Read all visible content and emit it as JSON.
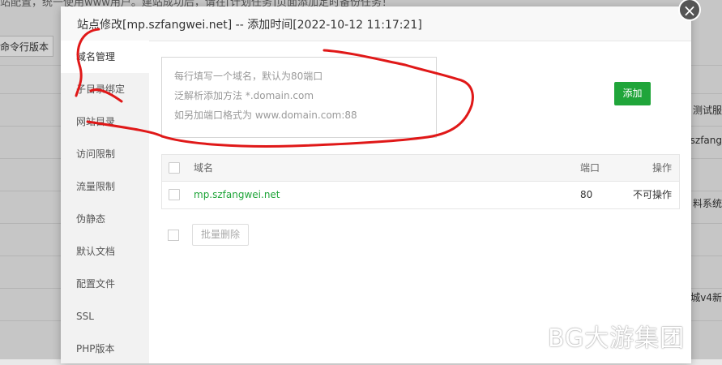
{
  "background": {
    "notice": "站配置，统一使用www用户。建站成功后，请在[计划任务]页面添加定时备份任务！",
    "cmd_button": "命令行版本",
    "right_texts": [
      "测试服",
      "szfang",
      "料系统",
      "城v4新"
    ]
  },
  "modal": {
    "title": "站点修改[mp.szfangwei.net] -- 添加时间[2022-10-12 11:17:21]",
    "close_glyph": "×"
  },
  "menu": {
    "items": [
      {
        "label": "域名管理",
        "active": true
      },
      {
        "label": "子目录绑定",
        "active": false
      },
      {
        "label": "网站目录",
        "active": false
      },
      {
        "label": "访问限制",
        "active": false
      },
      {
        "label": "流量限制",
        "active": false
      },
      {
        "label": "伪静态",
        "active": false
      },
      {
        "label": "默认文档",
        "active": false
      },
      {
        "label": "配置文件",
        "active": false
      },
      {
        "label": "SSL",
        "active": false
      },
      {
        "label": "PHP版本",
        "active": false
      }
    ]
  },
  "domain_input": {
    "hints": [
      "每行填写一个域名，默认为80端口",
      "泛解析添加方法 *.domain.com",
      "如另加端口格式为 www.domain.com:88"
    ]
  },
  "add_button": "添加",
  "table": {
    "headers": {
      "domain": "域名",
      "port": "端口",
      "action": "操作"
    },
    "rows": [
      {
        "domain": "mp.szfangwei.net",
        "port": "80",
        "action": "不可操作"
      }
    ]
  },
  "batch_delete": "批量删除",
  "watermark": "BG大游集团",
  "colors": {
    "accent": "#20a53a",
    "annotation": "#e01818"
  }
}
